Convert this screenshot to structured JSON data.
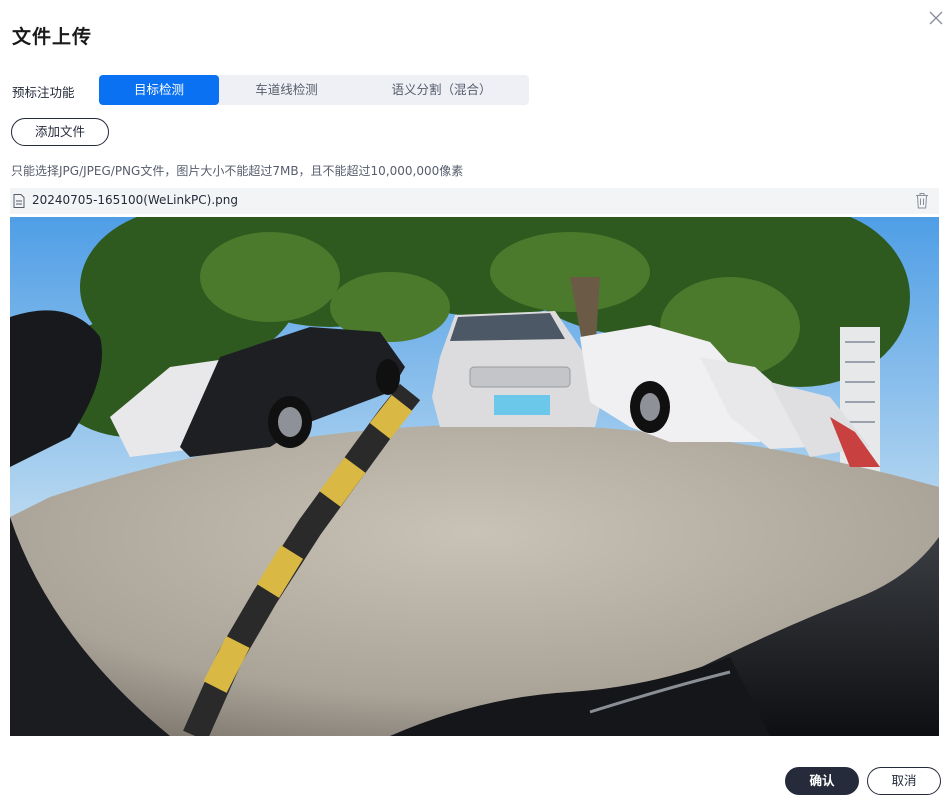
{
  "dialog": {
    "title": "文件上传"
  },
  "annotation": {
    "label": "预标注功能",
    "options": [
      "目标检测",
      "车道线检测",
      "语义分割（混合）"
    ],
    "selected_index": 0
  },
  "upload": {
    "add_button": "添加文件",
    "hint": "只能选择JPG/JPEG/PNG文件，图片大小不能超过7MB，且不能超过10,000,000像素"
  },
  "file": {
    "name": "20240705-165100(WeLinkPC).png"
  },
  "footer": {
    "confirm": "确认",
    "cancel": "取消"
  },
  "colors": {
    "accent": "#0a71f2",
    "dark_button": "#252b3a"
  },
  "icons": {
    "close": "close-icon",
    "file": "file-icon",
    "delete": "trash-icon"
  }
}
